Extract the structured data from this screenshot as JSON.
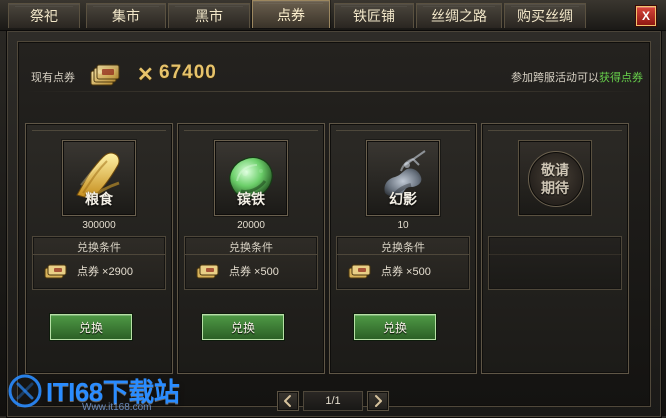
{
  "tabs": [
    {
      "label": "祭祀"
    },
    {
      "label": "集市"
    },
    {
      "label": "黑市"
    },
    {
      "label": "点券"
    },
    {
      "label": "铁匠铺"
    },
    {
      "label": "丝绸之路"
    },
    {
      "label": "购买丝绸"
    }
  ],
  "active_tab_index": 3,
  "window": {
    "close_label": "X"
  },
  "header": {
    "points_label": "现有点券",
    "multiplier_symbol": "✕",
    "points_value": "67400",
    "event_text": "参加跨服活动可以",
    "event_link": "获得点券",
    "colors": {
      "gold": "#e7c36b",
      "green": "#67d14b"
    }
  },
  "items": [
    {
      "name": "粮食",
      "quantity": "300000",
      "condition_title": "兑换条件",
      "cost_text": "点券 ×2900",
      "button_label": "兑换",
      "icon": "grain-icon"
    },
    {
      "name": "镔铁",
      "quantity": "20000",
      "condition_title": "兑换条件",
      "cost_text": "点券 ×500",
      "button_label": "兑换",
      "icon": "iron-ore-icon"
    },
    {
      "name": "幻影",
      "quantity": "10",
      "condition_title": "兑换条件",
      "cost_text": "点券 ×500",
      "button_label": "兑换",
      "icon": "phantom-rider-icon"
    }
  ],
  "coming_soon": {
    "line1": "敬请",
    "line2": "期待"
  },
  "pagination": {
    "text": "1/1",
    "prev_icon": "left-arrow-icon",
    "next_icon": "right-arrow-icon"
  },
  "watermark": {
    "title": "ITI68下载站",
    "sub": "Www.it168.com"
  }
}
